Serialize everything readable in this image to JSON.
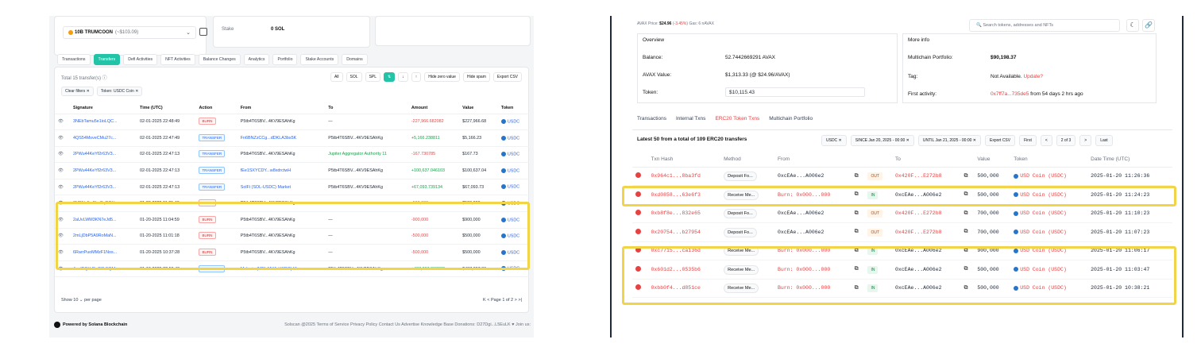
{
  "left": {
    "token_select": {
      "name": "10B TRUMCOON",
      "value": "(~$103.09)"
    },
    "stake": {
      "label": "Stake",
      "value": "0 SOL"
    },
    "tabs": [
      "Transactions",
      "Transfers",
      "Defi Activities",
      "NFT Activities",
      "Balance Changes",
      "Analytics",
      "Portfolio",
      "Stake Accounts",
      "Domains"
    ],
    "active_tab": "Transfers",
    "total": "Total 15 transfer(s) ⓘ",
    "filter_buttons": [
      "All",
      "SOL",
      "SPL",
      "⇅",
      "↓",
      "↑"
    ],
    "hide_zero": "Hide zero value",
    "hide_spam": "Hide spam",
    "export": "Export CSV",
    "chips": [
      "Clear filters ✕",
      "Token: USDC Coin ✕"
    ],
    "columns": [
      "Signature",
      "Time (UTC)",
      "Action",
      "From",
      "To",
      "Amount",
      "Value",
      "Token"
    ],
    "rows": [
      {
        "sig": "3NEbTamu5e1ioLQC...",
        "time": "02-01-2025 22:48:49",
        "action": "BURN",
        "from": "P5tb4T6SBV...4KV9ESAhKg",
        "to": "—",
        "amount": "-227,966.682082",
        "value": "$227,966.68",
        "token": "USDC"
      },
      {
        "sig": "4QS54MsveCMu27c...",
        "time": "02-01-2025 22:47:49",
        "action": "TRANSFER",
        "from": "Fn6BNZzCCg...dDKLA3bs5K",
        "to": "P5tb4T6SBV...4KV9ESAhKg",
        "amount": "+5,166.238811",
        "value": "$5,166.23",
        "token": "USDC"
      },
      {
        "sig": "2PWu44KeYf2r63V3...",
        "time": "02-01-2025 22:47:13",
        "action": "TRANSFER",
        "from": "P5tb4T6SBV...4KV9ESAhKg",
        "to": "Jupiter Aggregator Authority 11",
        "amount": "-167.730785",
        "value": "$167.73",
        "token": "USDC"
      },
      {
        "sig": "2PWu44KeYf2r63V3...",
        "time": "02-01-2025 22:47:13",
        "action": "TRANSFER",
        "from": "fEe1SXYCDY...w8xdrctwH",
        "to": "P5tb4T6SBV...4KV9ESAhKg",
        "amount": "+100,637.046103",
        "value": "$100,637.04",
        "token": "USDC"
      },
      {
        "sig": "2PWu44KeYf2r63V3...",
        "time": "02-01-2025 22:47:13",
        "action": "TRANSFER",
        "from": "SolFi (SOL-USDC) Market",
        "to": "P5tb4T6SBV...4KV9ESAhKg",
        "amount": "+67,093.739134",
        "value": "$67,093.73",
        "token": "USDC"
      },
      {
        "sig": "3NRNo5w8hoCqRGH...",
        "time": "01-20-2025 11:21:40",
        "action": "BURN",
        "from": "P5tb4T6SBV...4KV9ESAhKg",
        "to": "—",
        "amount": "-500,000",
        "value": "$500,000",
        "token": "USDC"
      },
      {
        "sig": "2aUvLWM3KN7eJd5...",
        "time": "01-20-2025 11:04:59",
        "action": "BURN",
        "from": "P5tb4T6SBV...4KV9ESAhKg",
        "to": "—",
        "amount": "-900,000",
        "value": "$900,000",
        "token": "USDC"
      },
      {
        "sig": "2mLjDbP5A9RoMaN...",
        "time": "01-20-2025 11:01:18",
        "action": "BURN",
        "from": "P5tb4T6SBV...4KV9ESAhKg",
        "to": "—",
        "amount": "-500,000",
        "value": "$500,000",
        "token": "USDC"
      },
      {
        "sig": "6RarrPuoMMzF1Nos...",
        "time": "01-20-2025 10:37:28",
        "action": "BURN",
        "from": "P5tb4T6SBV...4KV9ESAhKg",
        "to": "—",
        "amount": "-500,000",
        "value": "$500,000",
        "token": "USDC"
      },
      {
        "sig": "4mdDQkV8uG8bFQM...",
        "time": "01-19-2025 22:59:49",
        "action": "TRANSFER",
        "from": "Melania (MELANIA-USDC) Ma...",
        "to": "P5tb4T6SBV...4KV9ESAhKg",
        "amount": "+437,397.368833",
        "value": "$437,397.36",
        "token": "USDC"
      }
    ],
    "show": "Show  10  ⌄  per page",
    "pager": "K   <   Page 1 of 2   >   >|",
    "footer": {
      "brand": "Powered by Solana Blockchain",
      "links": "Solscan @2025   Terms of Service   Privacy Policy   Contact Us   Advertise   Knowledge Base   Donations: D27Dgi...L5EuLK ♥   Join us:"
    }
  },
  "right": {
    "topbar": {
      "label": "AVAX Price:",
      "price": "$24.96",
      "change": "(-3.45%)",
      "gas": "Gas: 6 nAVAX"
    },
    "search_placeholder": "Search tokens, addresses and NFTs",
    "overview": {
      "title": "Overview",
      "balance_label": "Balance:",
      "balance": "52.7442669291 AVAX",
      "value_label": "AVAX Value:",
      "value": "$1,313.33 (@ $24.96/AVAX)",
      "token_label": "Token:",
      "token": "$10,115.43"
    },
    "more_info": {
      "title": "More info",
      "multichain_label": "Multichain Portfolio:",
      "multichain": "$90,198.37",
      "tag_label": "Tag:",
      "tag": "Not Available.",
      "tag_link": "Update?",
      "first_label": "First activity:",
      "first_tx": "0x7ff7a...735de5",
      "first_ago": "from 54 days 2 hrs ago"
    },
    "tabs": [
      "Transactions",
      "Internal Txns",
      "ERC20 Token Txns",
      "Multichain Portfolio"
    ],
    "active_tab": "ERC20 Token Txns",
    "latest": "Latest 50 from a total of 109 ERC20 transfers",
    "chips": [
      "USDC ✕",
      "SINCE Jan 20, 2025 - 00:00 ✕",
      "UNTIL Jan 21, 2025 - 00:00 ✕",
      "Export CSV",
      "First",
      "<",
      "2 of 3",
      ">",
      "Last"
    ],
    "columns": [
      "",
      "Txn Hash",
      "Method",
      "From",
      "",
      "",
      "To",
      "",
      "Value",
      "Token",
      "Date Time (UTC)"
    ],
    "rows": [
      {
        "hash": "0x964c1...8ba3fd",
        "method": "Deposit Fo...",
        "from": "0xcEAe...A006e2",
        "dir": "OUT",
        "to": "0x420F...E272b8",
        "value": "500,000",
        "token": "USD Coin (USDC)",
        "time": "2025-01-20 11:26:36"
      },
      {
        "hash": "0xd0858...63e6f3",
        "method": "Receive Me...",
        "from": "Burn: 0x000...000",
        "dir": "IN",
        "to": "0xcEAe...A006e2",
        "value": "500,000",
        "token": "USD Coin (USDC)",
        "time": "2025-01-20 11:24:23"
      },
      {
        "hash": "0xb8f8e...832e65",
        "method": "Deposit Fo...",
        "from": "0xcEAe...A006e2",
        "dir": "OUT",
        "to": "0x420F...E272b8",
        "value": "700,000",
        "token": "USD Coin (USDC)",
        "time": "2025-01-20 11:10:23"
      },
      {
        "hash": "0x20754...b27954",
        "method": "Deposit Fo...",
        "from": "0xcEAe...A006e2",
        "dir": "OUT",
        "to": "0x420F...E272b8",
        "value": "700,000",
        "token": "USD Coin (USDC)",
        "time": "2025-01-20 11:07:23"
      },
      {
        "hash": "0xc7715...ca136d",
        "method": "Receive Me...",
        "from": "Burn: 0x000...000",
        "dir": "IN",
        "to": "0xcEAe...A006e2",
        "value": "900,000",
        "token": "USD Coin (USDC)",
        "time": "2025-01-20 11:06:17"
      },
      {
        "hash": "0x601d2...0535b6",
        "method": "Receive Me...",
        "from": "Burn: 0x000...000",
        "dir": "IN",
        "to": "0xcEAe...A006e2",
        "value": "500,000",
        "token": "USD Coin (USDC)",
        "time": "2025-01-20 11:03:47"
      },
      {
        "hash": "0xbb0f4...d851ce",
        "method": "Receive Me...",
        "from": "Burn: 0x000...000",
        "dir": "IN",
        "to": "0xcEAe...A006e2",
        "value": "500,000",
        "token": "USD Coin (USDC)",
        "time": "2025-01-20 10:38:21"
      }
    ]
  },
  "colors": {
    "solscan_accent": "#22c3a6",
    "avax_red": "#e84142",
    "highlight": "#f1d448"
  }
}
